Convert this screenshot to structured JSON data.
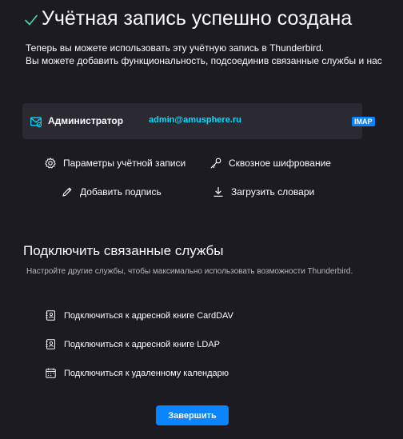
{
  "header": {
    "title": "Учётная запись успешно создана",
    "check_icon": "checkmark-icon",
    "check_color": "#3fe1b0"
  },
  "intro": {
    "line1": "Теперь вы можете использовать эту учётную запись в Thunderbird.",
    "line2": "Вы можете добавить функциональность, подсоединив связанные службы и нас"
  },
  "account": {
    "icon": "mail-account-icon",
    "name": "Администратор",
    "email": "admin@amusphere.ru",
    "badge": "IMAP",
    "email_color": "#00ddff",
    "badge_color": "#0a84ff"
  },
  "actions": {
    "account_settings": "Параметры учётной записи",
    "e2e_encryption": "Сквозное шифрование",
    "add_signature": "Добавить подпись",
    "download_dictionaries": "Загрузить словари"
  },
  "services": {
    "title": "Подключить связанные службы",
    "description": "Настройте другие службы, чтобы максимально использовать возможности Thunderbird.",
    "items": [
      {
        "label": "Подключиться к адресной книге CardDAV",
        "icon": "address-book-icon"
      },
      {
        "label": "Подключиться к адресной книге LDAP",
        "icon": "address-book-icon"
      },
      {
        "label": "Подключиться к удаленному календарю",
        "icon": "calendar-icon"
      }
    ]
  },
  "footer": {
    "finish_label": "Завершить",
    "accent_color": "#0a84ff"
  }
}
